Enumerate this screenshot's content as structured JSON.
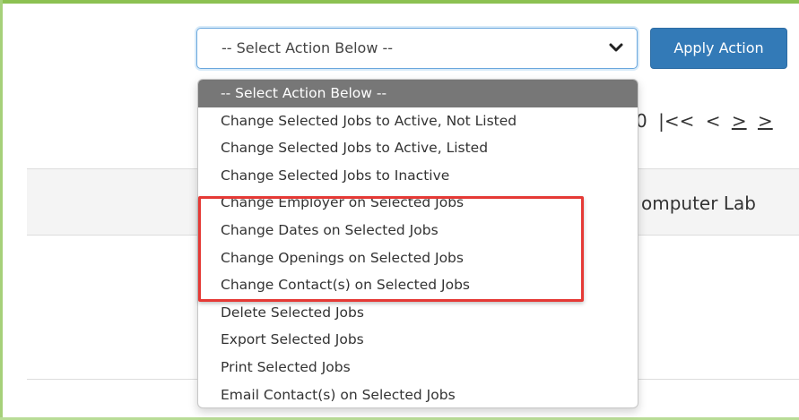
{
  "toolbar": {
    "select_value": "-- Select Action Below --",
    "apply_label": "Apply Action"
  },
  "pager": {
    "count_fragment": "0",
    "sep": "|<<",
    "prev": "<",
    "next": ">",
    "next2": ">"
  },
  "table": {
    "column_fragment": "omputer Lab"
  },
  "dropdown": {
    "items": [
      "-- Select Action Below --",
      "Change Selected Jobs to Active, Not Listed",
      "Change Selected Jobs to Active, Listed",
      "Change Selected Jobs to Inactive",
      "Change Employer on Selected Jobs",
      "Change Dates on Selected Jobs",
      "Change Openings on Selected Jobs",
      "Change Contact(s) on Selected Jobs",
      "Delete Selected Jobs",
      "Export Selected Jobs",
      "Print Selected Jobs",
      "Email Contact(s) on Selected Jobs"
    ]
  },
  "colors": {
    "accent_green": "#8cc152",
    "button_blue": "#337ab7",
    "highlight_red": "#e53935",
    "selected_gray": "#777777"
  },
  "icons": {
    "select_arrow": "chevron-down-icon"
  }
}
